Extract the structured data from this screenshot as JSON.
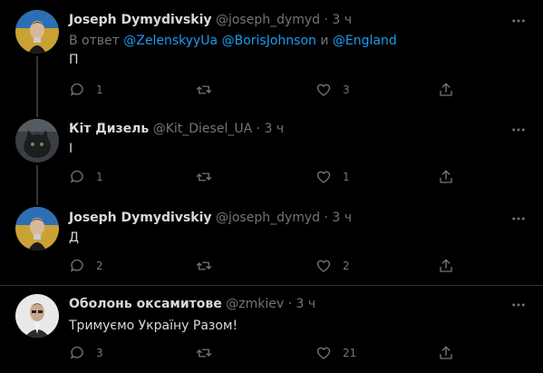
{
  "colors": {
    "background": "#000000",
    "text": "#d9d9d9",
    "muted": "#6e767d",
    "accent": "#1d9bf0"
  },
  "tweets": [
    {
      "name": "Joseph Dymydivskiy",
      "handle": "@joseph_dymyd",
      "sep": "·",
      "time": "3 ч",
      "reply_prefix": "В ответ",
      "mentions": [
        "@ZelenskyyUa",
        "@BorisJohnson",
        "@England"
      ],
      "reply_and": "и",
      "text": "П",
      "replies": "1",
      "retweets": "",
      "likes": "3"
    },
    {
      "name": "Кіт Дизель",
      "handle": "@Kit_Diesel_UA",
      "sep": "·",
      "time": "3 ч",
      "text": "І",
      "replies": "1",
      "retweets": "",
      "likes": "1"
    },
    {
      "name": "Joseph Dymydivskiy",
      "handle": "@joseph_dymyd",
      "sep": "·",
      "time": "3 ч",
      "text": "Д",
      "replies": "2",
      "retweets": "",
      "likes": "2"
    },
    {
      "name": "Оболонь оксамитове",
      "handle": "@zmkiev",
      "sep": "·",
      "time": "3 ч",
      "text": "Тримуємо Україну Разом!",
      "replies": "3",
      "retweets": "",
      "likes": "21"
    }
  ]
}
